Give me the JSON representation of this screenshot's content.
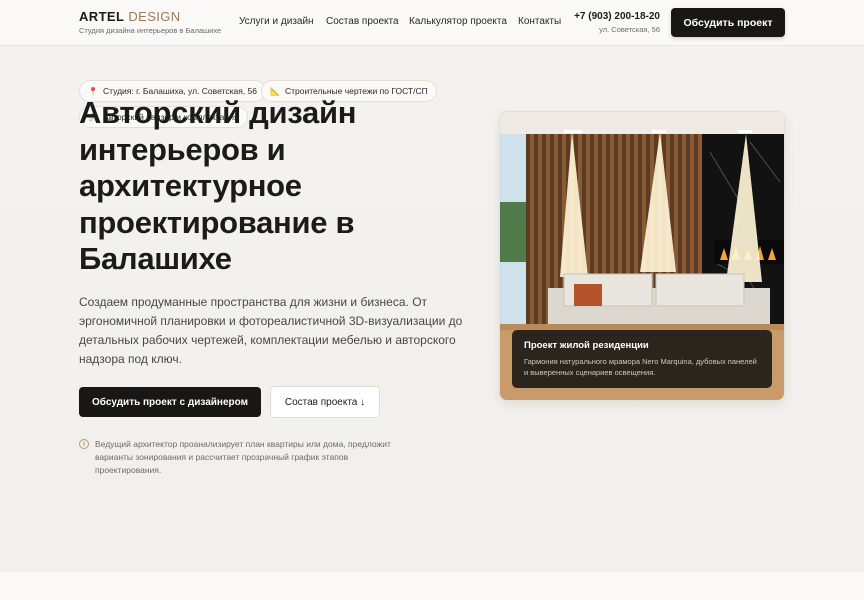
{
  "header": {
    "logo_bold": "ARTEL",
    "logo_light": " DESIGN",
    "logo_sub": "Студия дизайна интерьеров в Балашихе",
    "nav": [
      {
        "label": "Услуги и дизайн"
      },
      {
        "label": "Состав проекта"
      },
      {
        "label": "Калькулятор проекта"
      },
      {
        "label": "Контакты"
      }
    ],
    "phone": "+7 (903) 200-18-20",
    "address": "ул. Советская, 56",
    "cta": "Обсудить проект"
  },
  "hero": {
    "chips": [
      {
        "icon": "pin-icon",
        "label": "Студия: г. Балашиха, ул. Советская, 56"
      },
      {
        "icon": "ruler-icon",
        "label": "Строительные чертежи по ГОСТ/СП"
      },
      {
        "icon": "tools-icon",
        "label": "Авторский надзор и комплектация"
      }
    ],
    "title": "Авторский дизайн интерьеров и архитектурное проектирование в Балашихе",
    "lead": "Создаем продуманные пространства для жизни и бизнеса. От эргономичной планировки и фотореалистичной 3D-визуализации до детальных рабочих чертежей, комплектации мебелью и авторского надзора под ключ.",
    "primary_button": "Обсудить проект с дизайнером",
    "secondary_button": "Состав проекта ↓",
    "note_icon": "i",
    "note": "Ведущий архитектор проанализирует план квартиры или дома, предложит варианты зонирования и рассчитает прозрачный график этапов проектирования."
  },
  "card": {
    "caption_title": "Проект жилой резиденции",
    "caption_text": "Гармония натурального мрамора Nero Marquina, дубовых панелей и выверенных сценариев освещения."
  },
  "colors": {
    "accent": "#9a7b55",
    "dark": "#181715",
    "background": "#f4f2ee"
  }
}
